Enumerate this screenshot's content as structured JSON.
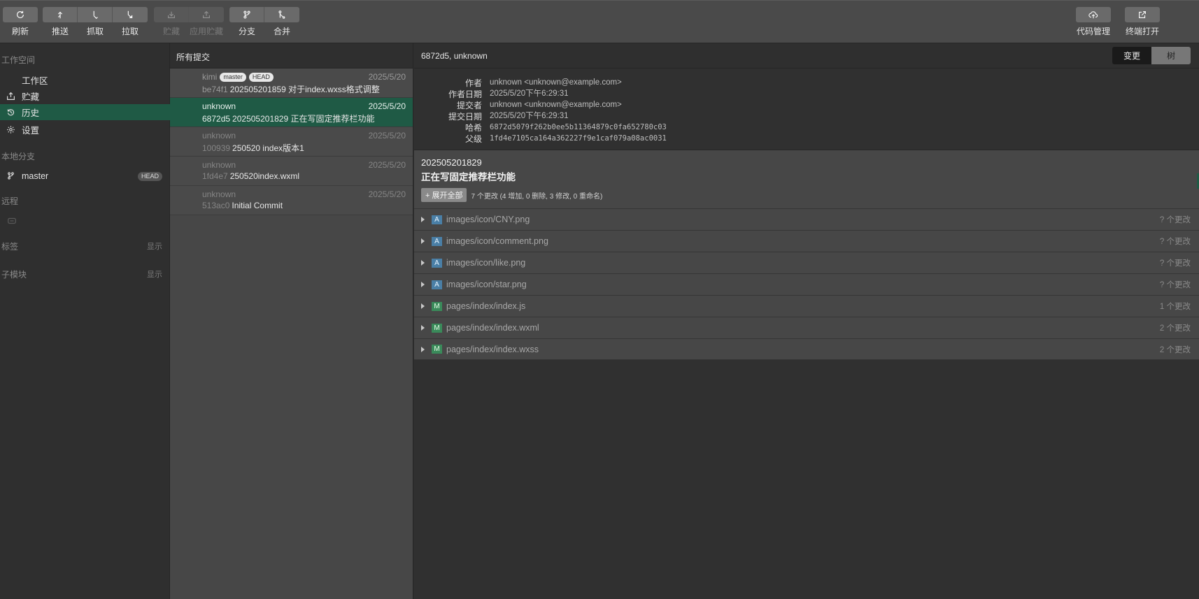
{
  "toolbar": {
    "refresh": "刷新",
    "push": "推送",
    "fetch": "抓取",
    "pull": "拉取",
    "stash": "贮藏",
    "apply_stash": "应用贮藏",
    "branch": "分支",
    "merge": "合并",
    "code_manage": "代码管理",
    "open_terminal": "终端打开"
  },
  "sidebar": {
    "workspace_title": "工作空间",
    "items": [
      {
        "label": "工作区",
        "icon": "none"
      },
      {
        "label": "贮藏",
        "icon": "stash-icon"
      },
      {
        "label": "历史",
        "icon": "history-icon"
      },
      {
        "label": "设置",
        "icon": "gear-icon"
      }
    ],
    "local_branches_title": "本地分支",
    "branch": {
      "name": "master",
      "badge": "HEAD"
    },
    "remote_title": "远程",
    "tags_title": "标签",
    "tags_show": "显示",
    "submodules_title": "子模块",
    "submodules_show": "显示"
  },
  "commits": {
    "header": "所有提交",
    "list": [
      {
        "author": "kimi",
        "badges": [
          "master",
          "HEAD"
        ],
        "date": "2025/5/20",
        "hash": "be74f1",
        "message": "202505201859 对于index.wxss格式调整"
      },
      {
        "author": "unknown",
        "badges": [],
        "date": "2025/5/20",
        "hash": "6872d5",
        "message": "202505201829 正在写固定推荐栏功能"
      },
      {
        "author": "unknown",
        "badges": [],
        "date": "2025/5/20",
        "hash": "100939",
        "message": "250520 index版本1"
      },
      {
        "author": "unknown",
        "badges": [],
        "date": "2025/5/20",
        "hash": "1fd4e7",
        "message": "250520index.wxml"
      },
      {
        "author": "unknown",
        "badges": [],
        "date": "2025/5/20",
        "hash": "513ac0",
        "message": "Initial Commit"
      }
    ]
  },
  "detail": {
    "header": "6872d5, unknown",
    "tab_changes": "变更",
    "tab_tree": "树",
    "meta": [
      {
        "key": "作者",
        "value": "unknown <unknown@example.com>",
        "mono": false
      },
      {
        "key": "作者日期",
        "value": "2025/5/20下午6:29:31",
        "mono": false
      },
      {
        "key": "提交者",
        "value": "unknown <unknown@example.com>",
        "mono": false
      },
      {
        "key": "提交日期",
        "value": "2025/5/20下午6:29:31",
        "mono": false
      },
      {
        "key": "哈希",
        "value": "6872d5079f262b0ee5b11364879c0fa652780c03",
        "mono": true
      },
      {
        "key": "父级",
        "value": "1fd4e7105ca164a362227f9e1caf079a08ac0031",
        "mono": true
      }
    ],
    "title_line1": "202505201829",
    "title_line2": "正在写固定推荐栏功能",
    "expand_all": "+ 展开全部",
    "stats": "7 个更改 (4 增加, 0 删除, 3 修改, 0 重命名)",
    "files": [
      {
        "status": "A",
        "path": "images/icon/CNY.png",
        "count": "? 个更改"
      },
      {
        "status": "A",
        "path": "images/icon/comment.png",
        "count": "? 个更改"
      },
      {
        "status": "A",
        "path": "images/icon/like.png",
        "count": "? 个更改"
      },
      {
        "status": "A",
        "path": "images/icon/star.png",
        "count": "? 个更改"
      },
      {
        "status": "M",
        "path": "pages/index/index.js",
        "count": "1 个更改"
      },
      {
        "status": "M",
        "path": "pages/index/index.wxml",
        "count": "2 个更改"
      },
      {
        "status": "M",
        "path": "pages/index/index.wxss",
        "count": "2 个更改"
      }
    ]
  }
}
